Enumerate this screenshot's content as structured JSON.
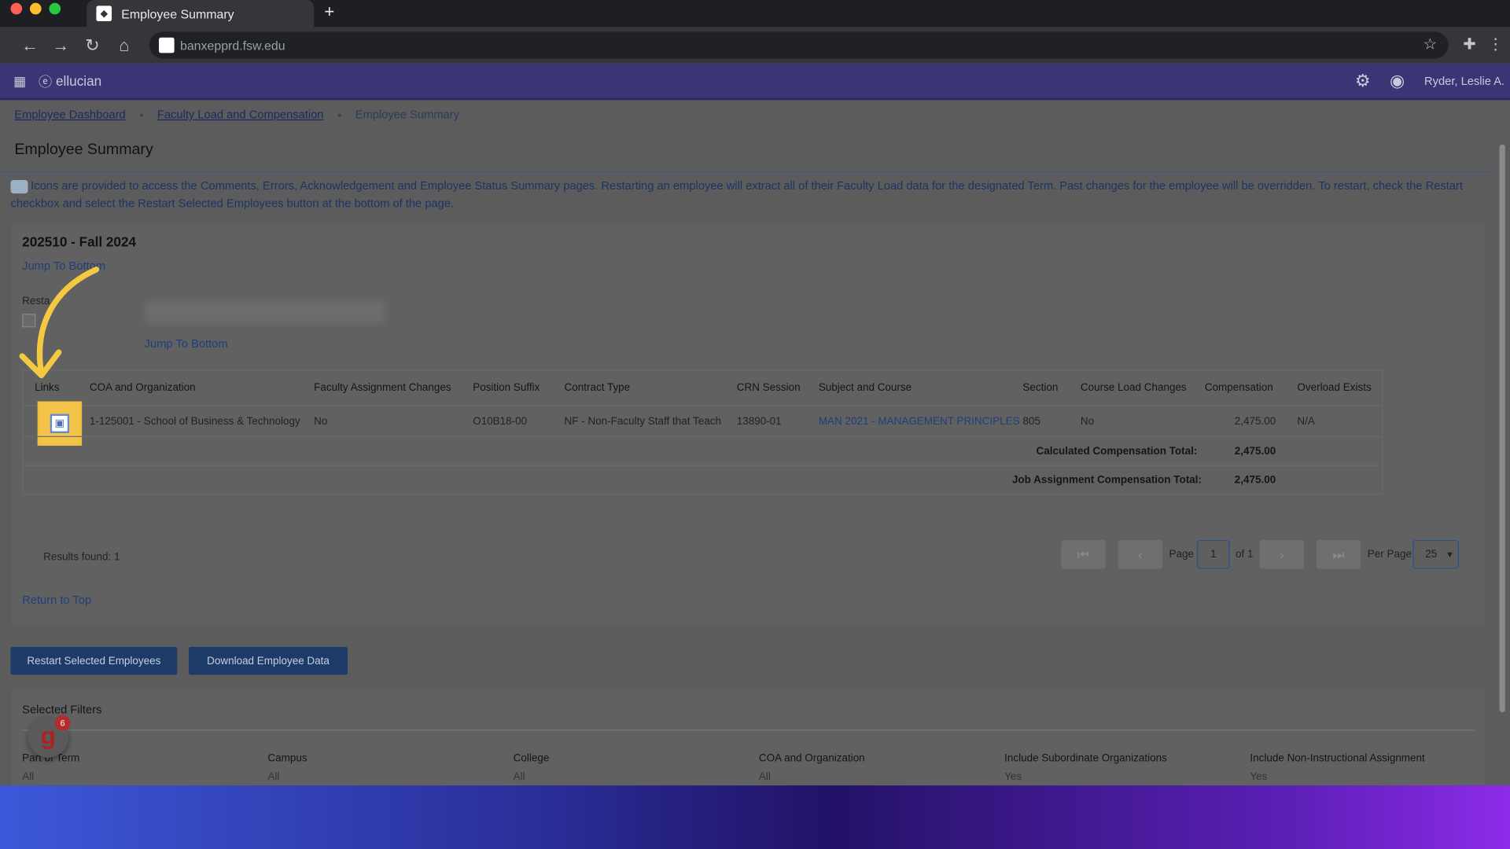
{
  "browser": {
    "tab_title": "Employee Summary",
    "url": "banxepprd.fsw.edu"
  },
  "appbar": {
    "brand": "ellucian",
    "user": "Ryder, Leslie A."
  },
  "breadcrumb": {
    "items": [
      "Employee Dashboard",
      "Faculty Load and Compensation",
      "Employee Summary"
    ]
  },
  "page_title": "Employee Summary",
  "info_text": "Icons are provided to access the Comments, Errors, Acknowledgement and Employee Status Summary pages. Restarting an employee will extract all of their Faculty Load data for the designated Term. Past changes for the employee will be overridden. To restart, check the Restart checkbox and select the Restart Selected Employees button at the bottom of the page.",
  "term": "202510 - Fall 2024",
  "jump_to_bottom": "Jump To Bottom",
  "restart_label": "Resta",
  "table": {
    "headers": [
      "Links",
      "COA and Organization",
      "Faculty Assignment Changes",
      "Position Suffix",
      "Contract Type",
      "CRN Session",
      "Subject and Course",
      "Section",
      "Course Load Changes",
      "Compensation",
      "Overload Exists"
    ],
    "row": {
      "coa": "1-125001 - School of Business & Technology",
      "fac_changes": "No",
      "position_suffix": "O10B18-00",
      "contract_type": "NF - Non-Faculty Staff that Teach",
      "crn_session": "13890-01",
      "subject_course": "MAN 2021 - MANAGEMENT PRINCIPLES",
      "section": "805",
      "course_load_changes": "No",
      "compensation": "2,475.00",
      "overload": "N/A"
    },
    "calc_total_label": "Calculated Compensation Total:",
    "calc_total": "2,475.00",
    "job_total_label": "Job Assignment Compensation Total:",
    "job_total": "2,475.00"
  },
  "pagination": {
    "results": "Results found: 1",
    "page_label": "Page",
    "page": "1",
    "of": "of 1",
    "per_page_label": "Per Page",
    "per_page": "25"
  },
  "return_to_top": "Return to Top",
  "buttons": {
    "restart": "Restart Selected Employees",
    "download": "Download Employee Data"
  },
  "filters": {
    "title": "Selected Filters",
    "columns": [
      {
        "label": "Part of Term",
        "value": "All"
      },
      {
        "label": "Campus",
        "value": "All"
      },
      {
        "label": "College",
        "value": "All"
      },
      {
        "label": "COA and Organization",
        "value": "All"
      },
      {
        "label": "Include Subordinate Organizations",
        "value": "Yes"
      },
      {
        "label": "Include Non-Instructional Assignment",
        "value": "Yes"
      }
    ]
  },
  "guide_badge": {
    "letter": "g",
    "count": "6"
  },
  "colors": {
    "highlight": "#f3c34a",
    "appbar": "#3a3575",
    "button": "#1d3b69"
  }
}
